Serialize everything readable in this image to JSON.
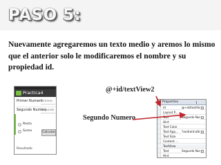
{
  "slide": {
    "title": "PASO 5:",
    "body": "Nuevamente agregaremos un texto medio y aremos lo mismo que el anterior solo le modificaremos el nombre y su propiedad id.",
    "id_label": "@+id/textView2",
    "name_label": "Segundo Numero"
  },
  "phone": {
    "app_name": "Practica4",
    "rows": [
      {
        "label": "Primer Numero",
        "hint": "Primero"
      },
      {
        "label": "Segundo Numero",
        "hint": "Segundo"
      }
    ],
    "radios": [
      "Resta",
      "Suma"
    ],
    "button": "Calcular",
    "result": "Resultado"
  },
  "properties": {
    "header": "Properties",
    "rows": [
      {
        "key": "Id",
        "value": "@+id/textView2"
      },
      {
        "key": "Layout P...",
        "value": ""
      },
      {
        "key": "Text",
        "value": "Segundo Numero"
      },
      {
        "key": "Hint",
        "value": ""
      },
      {
        "key": "Text Color",
        "value": ""
      },
      {
        "key": "Text App...",
        "value": "?android:attr/textAppear..."
      },
      {
        "key": "Text Size",
        "value": ""
      },
      {
        "key": "Content ...",
        "value": ""
      },
      {
        "key": "TextView",
        "value": ""
      },
      {
        "key": "Text",
        "value": "Segundo Numero"
      },
      {
        "key": "Hint",
        "value": ""
      }
    ]
  },
  "colors": {
    "arrow": "#c0282e",
    "title_fill": "#f8f8f8",
    "accent_green": "#6fc13c"
  }
}
